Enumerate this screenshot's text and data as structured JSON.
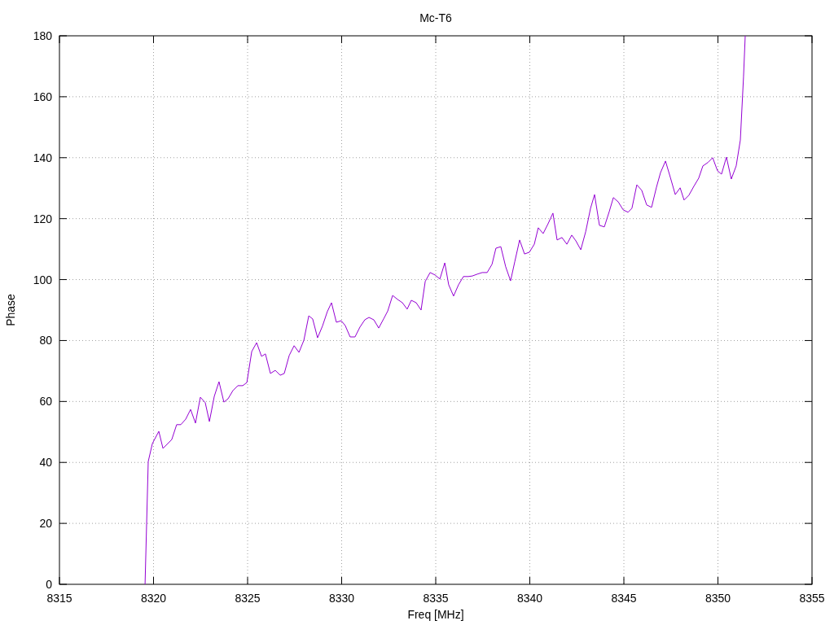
{
  "chart_data": {
    "type": "line",
    "grid": true,
    "title": "Mc-T6",
    "xlabel": "Freq [MHz]",
    "ylabel": "Phase",
    "xlim": [
      8315,
      8355
    ],
    "ylim": [
      0,
      180
    ],
    "xticks": [
      8315,
      8320,
      8325,
      8330,
      8335,
      8340,
      8345,
      8350,
      8355
    ],
    "yticks": [
      0,
      20,
      40,
      60,
      80,
      100,
      120,
      140,
      160,
      180
    ],
    "x": [
      8319.55,
      8319.72,
      8319.94,
      8320.28,
      8320.5,
      8320.76,
      8320.97,
      8321.23,
      8321.45,
      8321.71,
      8321.97,
      8322.23,
      8322.49,
      8322.75,
      8322.97,
      8323.23,
      8323.48,
      8323.74,
      8323.96,
      8324.22,
      8324.48,
      8324.74,
      8324.96,
      8325.22,
      8325.48,
      8325.74,
      8325.95,
      8326.21,
      8326.47,
      8326.73,
      8326.95,
      8327.21,
      8327.47,
      8327.73,
      8327.99,
      8328.25,
      8328.46,
      8328.72,
      8328.98,
      8329.24,
      8329.46,
      8329.72,
      8329.98,
      8330.19,
      8330.45,
      8330.71,
      8330.97,
      8331.23,
      8331.45,
      8331.71,
      8331.97,
      8332.23,
      8332.45,
      8332.71,
      8332.97,
      8333.23,
      8333.48,
      8333.7,
      8333.96,
      8334.22,
      8334.44,
      8334.7,
      8334.96,
      8335.22,
      8335.48,
      8335.69,
      8335.95,
      8336.21,
      8336.47,
      8336.73,
      8336.95,
      8337.21,
      8337.47,
      8337.73,
      8337.99,
      8338.2,
      8338.46,
      8338.72,
      8338.98,
      8339.2,
      8339.46,
      8339.72,
      8339.98,
      8340.24,
      8340.45,
      8340.71,
      8340.97,
      8341.23,
      8341.45,
      8341.71,
      8341.97,
      8342.23,
      8342.45,
      8342.71,
      8342.97,
      8343.23,
      8343.44,
      8343.7,
      8343.96,
      8344.22,
      8344.44,
      8344.7,
      8344.96,
      8345.22,
      8345.43,
      8345.69,
      8345.95,
      8346.21,
      8346.47,
      8346.73,
      8346.95,
      8347.21,
      8347.47,
      8347.73,
      8347.99,
      8348.2,
      8348.46,
      8348.72,
      8348.98,
      8349.2,
      8349.46,
      8349.72,
      8349.98,
      8350.19,
      8350.45,
      8350.71,
      8350.97,
      8351.19,
      8351.36,
      8351.45
    ],
    "series": [
      {
        "color": "#9400d3",
        "values": [
          0,
          40.3,
          46.2,
          50.2,
          44.6,
          46.2,
          47.5,
          52.4,
          52.4,
          54.2,
          57.4,
          52.9,
          61.4,
          59.6,
          53.4,
          61.7,
          66.5,
          59.8,
          60.9,
          63.6,
          65.2,
          65.2,
          66.2,
          76.4,
          79.3,
          74.8,
          75.6,
          69.2,
          70.2,
          68.6,
          69.2,
          75.1,
          78.3,
          76.1,
          80.1,
          88.1,
          87.1,
          80.9,
          84.7,
          89.5,
          92.4,
          86.0,
          86.5,
          84.9,
          81.2,
          81.2,
          84.4,
          86.8,
          87.6,
          86.8,
          84.1,
          87.1,
          89.7,
          94.8,
          93.5,
          92.4,
          90.3,
          93.2,
          92.4,
          90.0,
          99.4,
          102.3,
          101.5,
          100.2,
          105.5,
          98.3,
          94.6,
          98.3,
          101.0,
          101.0,
          101.2,
          101.8,
          102.3,
          102.3,
          105.0,
          110.3,
          110.8,
          104.2,
          99.6,
          105.8,
          113.0,
          108.4,
          109.0,
          111.6,
          117.0,
          115.1,
          118.3,
          121.8,
          113.0,
          113.8,
          111.6,
          114.6,
          112.7,
          109.8,
          115.7,
          123.4,
          127.9,
          117.8,
          117.3,
          122.3,
          126.9,
          125.5,
          122.9,
          122.1,
          123.4,
          131.1,
          129.3,
          124.5,
          123.7,
          130.3,
          135.1,
          138.9,
          133.5,
          127.9,
          130.1,
          126.1,
          127.7,
          130.6,
          133.3,
          137.3,
          138.4,
          140.0,
          135.7,
          134.6,
          140.2,
          133.0,
          137.3,
          145.8,
          166.4,
          180
        ]
      }
    ]
  }
}
